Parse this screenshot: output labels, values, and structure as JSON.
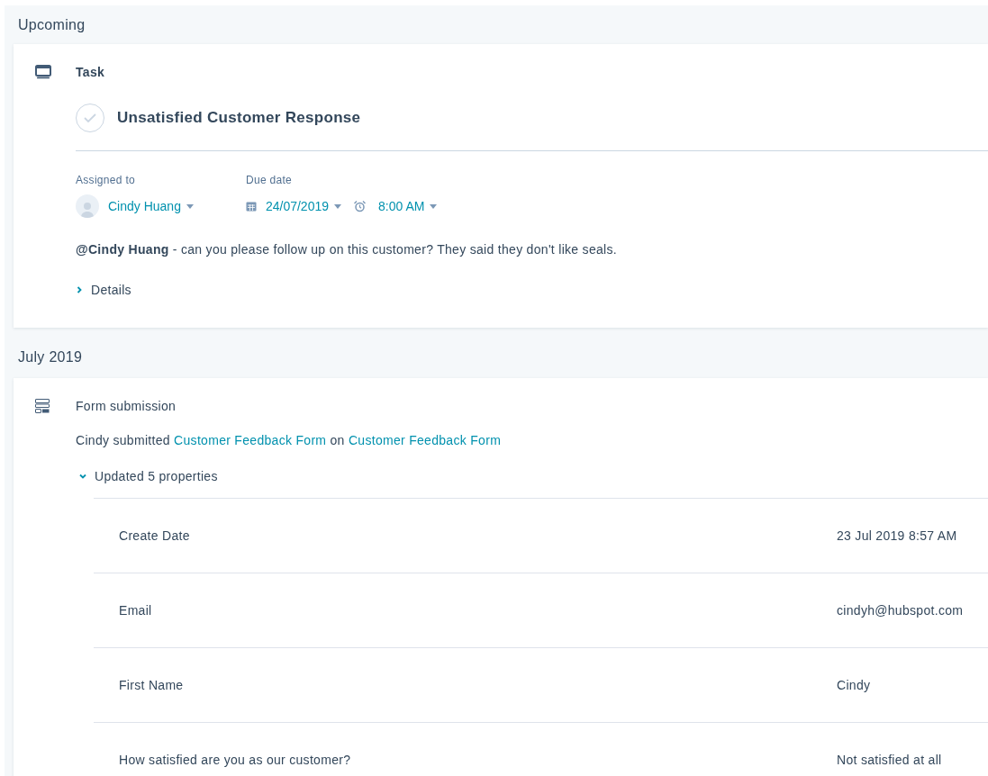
{
  "sections": [
    {
      "title": "Upcoming",
      "items": [
        {
          "kind": "task",
          "type_label": "Task",
          "title": "Unsatisfied Customer Response",
          "completed": false,
          "assigned_label": "Assigned to",
          "assignee": "Cindy Huang",
          "due_label": "Due date",
          "due_date": "24/07/2019",
          "due_time": "8:00 AM",
          "note": "**@Cindy Huang** - can you please follow up on this customer? They said they don't like seals.",
          "details": {
            "label": "Details",
            "expanded": false
          }
        }
      ]
    },
    {
      "title": "July 2019",
      "items": [
        {
          "kind": "form_submission",
          "type_label": "Form submission",
          "sentence": [
            {
              "kind": "text",
              "text": "Cindy submitted"
            },
            {
              "kind": "link",
              "text": "Customer Feedback Form"
            },
            {
              "kind": "text",
              "text": "on"
            },
            {
              "kind": "link",
              "text": "Customer Feedback Form"
            }
          ],
          "properties": {
            "label": "Updated 5 properties",
            "expanded": true,
            "rows": [
              {
                "name": "Create Date",
                "value": "23 Jul 2019 8:57 AM"
              },
              {
                "name": "Email",
                "value": "cindyh@hubspot.com"
              },
              {
                "name": "First Name",
                "value": "Cindy"
              },
              {
                "name": "How satisfied are you as our customer?",
                "value": "Not satisfied at all"
              }
            ]
          }
        }
      ]
    }
  ]
}
